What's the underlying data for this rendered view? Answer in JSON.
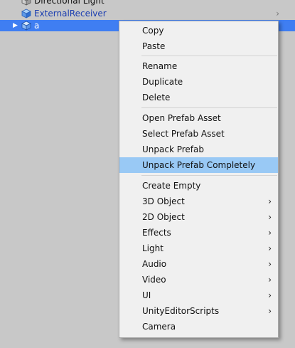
{
  "hierarchy": {
    "items": [
      {
        "label": "Directional Light"
      },
      {
        "label": "ExternalReceiver"
      },
      {
        "label": "a"
      }
    ]
  },
  "context_menu": {
    "items": [
      {
        "label": "Copy"
      },
      {
        "label": "Paste"
      },
      {
        "label": "Rename"
      },
      {
        "label": "Duplicate"
      },
      {
        "label": "Delete"
      },
      {
        "label": "Open Prefab Asset"
      },
      {
        "label": "Select Prefab Asset"
      },
      {
        "label": "Unpack Prefab"
      },
      {
        "label": "Unpack Prefab Completely",
        "highlighted": true
      },
      {
        "label": "Create Empty"
      },
      {
        "label": "3D Object",
        "submenu": true
      },
      {
        "label": "2D Object",
        "submenu": true
      },
      {
        "label": "Effects",
        "submenu": true
      },
      {
        "label": "Light",
        "submenu": true
      },
      {
        "label": "Audio",
        "submenu": true
      },
      {
        "label": "Video",
        "submenu": true
      },
      {
        "label": "UI",
        "submenu": true
      },
      {
        "label": "UnityEditorScripts",
        "submenu": true
      },
      {
        "label": "Camera"
      }
    ]
  },
  "colors": {
    "selection": "#3f7ef2",
    "menu_highlight": "#99c9f5",
    "prefab_text": "#1a3db0",
    "panel_bg": "#c8c8c8",
    "menu_bg": "#f0f0f0"
  },
  "icons": {
    "gameobject": "cube-icon",
    "prefab": "prefab-cube-icon",
    "submenu": "chevron-right-icon",
    "expand": "triangle-right-icon"
  }
}
